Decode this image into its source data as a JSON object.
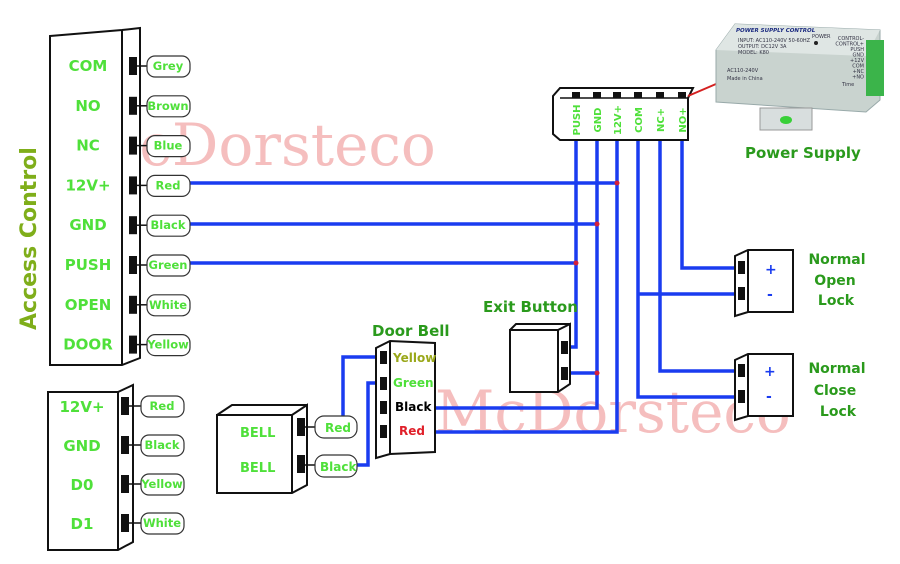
{
  "watermark": "McDorsteco",
  "access_control": {
    "title": "Access Control",
    "terminals": [
      {
        "label": "COM",
        "wire": "Grey"
      },
      {
        "label": "NO",
        "wire": "Brown"
      },
      {
        "label": "NC",
        "wire": "Blue"
      },
      {
        "label": "12V+",
        "wire": "Red"
      },
      {
        "label": "GND",
        "wire": "Black"
      },
      {
        "label": "PUSH",
        "wire": "Green"
      },
      {
        "label": "OPEN",
        "wire": "White"
      },
      {
        "label": "DOOR",
        "wire": "Yellow"
      }
    ]
  },
  "reader": {
    "terminals": [
      {
        "label": "12V+",
        "wire": "Red"
      },
      {
        "label": "GND",
        "wire": "Black"
      },
      {
        "label": "D0",
        "wire": "Yellow"
      },
      {
        "label": "D1",
        "wire": "White"
      }
    ]
  },
  "bell": {
    "terminals": [
      "BELL",
      "BELL"
    ],
    "wires": [
      "Red",
      "Black"
    ]
  },
  "door_bell": {
    "title": "Door Bell",
    "terminals": [
      "Yellow",
      "Green",
      "Black",
      "Red"
    ]
  },
  "exit_button": {
    "title": "Exit Button"
  },
  "power_supply": {
    "title": "Power Supply",
    "terminals": [
      "PUSH",
      "GND",
      "12V+",
      "COM",
      "NC+",
      "NO+"
    ],
    "device": {
      "heading": "POWER SUPPLY CONTROL",
      "input": "INPUT: AC110-240V 50-60HZ",
      "output": "OUTPUT: DC12V 3A",
      "model": "MODEL: K80",
      "ac": "AC110-240V",
      "made": "Made in China",
      "power": "POWER",
      "side_labels": [
        "CONTROL-",
        "CONTROL+",
        "PUSH",
        "GND",
        "+12V",
        "COM",
        "+NC",
        "+NO"
      ],
      "time": "Time"
    }
  },
  "normal_open_lock": {
    "title": [
      "Normal",
      "Open",
      "Lock"
    ],
    "plus": "+",
    "minus": "-"
  },
  "normal_close_lock": {
    "title": [
      "Normal",
      "Close",
      "Lock"
    ],
    "plus": "+",
    "minus": "-"
  },
  "colors": {
    "wire": "#1a3cf0",
    "label_green": "#4fe03a",
    "title_green": "#2a9a1c",
    "junction": "#d4203a",
    "watermark": "#f2a9a9"
  }
}
